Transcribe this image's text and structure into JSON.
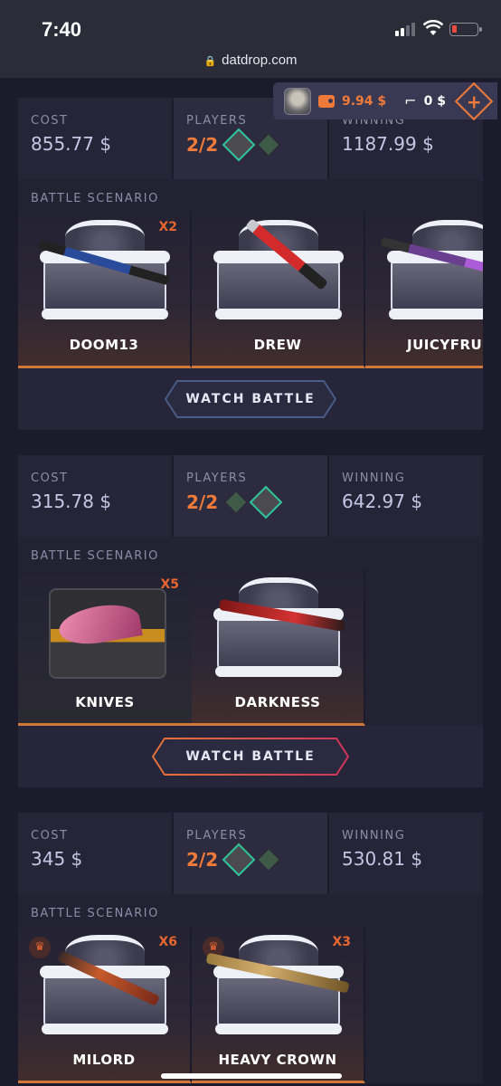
{
  "status_bar": {
    "time": "7:40"
  },
  "browser": {
    "url": "datdrop.com"
  },
  "wallet": {
    "balance": "9.94 $",
    "gun_balance": "0 $",
    "add_label": "+"
  },
  "battles": [
    {
      "cost_label": "COST",
      "cost": "855.77 $",
      "players_label": "PLAYERS",
      "players": "2/2",
      "winning_label": "WINNING",
      "winning": "1187.99 $",
      "scenario_label": "BATTLE SCENARIO",
      "cases": [
        {
          "name": "DOOM13",
          "multiplier": "X2"
        },
        {
          "name": "DREW",
          "multiplier": ""
        },
        {
          "name": "JUICYFRUITY",
          "multiplier": ""
        }
      ],
      "watch_label": "WATCH BATTLE"
    },
    {
      "cost_label": "COST",
      "cost": "315.78 $",
      "players_label": "PLAYERS",
      "players": "2/2",
      "winning_label": "WINNING",
      "winning": "642.97 $",
      "scenario_label": "BATTLE SCENARIO",
      "cases": [
        {
          "name": "KNIVES",
          "multiplier": "X5"
        },
        {
          "name": "DARKNESS",
          "multiplier": ""
        }
      ],
      "watch_label": "WATCH BATTLE"
    },
    {
      "cost_label": "COST",
      "cost": "345 $",
      "players_label": "PLAYERS",
      "players": "2/2",
      "winning_label": "WINNING",
      "winning": "530.81 $",
      "scenario_label": "BATTLE SCENARIO",
      "cases": [
        {
          "name": "MILORD",
          "multiplier": "X6"
        },
        {
          "name": "HEAVY CROWN",
          "multiplier": "X3"
        }
      ]
    }
  ]
}
